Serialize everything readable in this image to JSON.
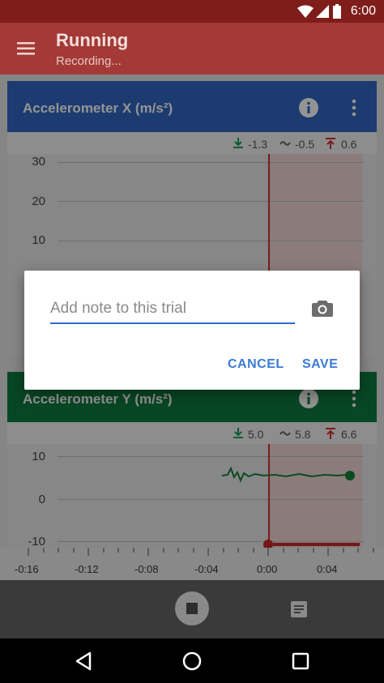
{
  "status_bar": {
    "time": "6:00",
    "icons": [
      "wifi-icon",
      "cell-signal-icon",
      "battery-icon"
    ]
  },
  "app_bar": {
    "title": "Running",
    "subtitle": "Recording...",
    "menu_icon": "hamburger-menu-icon"
  },
  "card_x": {
    "title": "Accelerometer X (m/s²)",
    "color": "#3167c1",
    "stats": {
      "min": "-1.3",
      "avg": "-0.5",
      "max": "0.6"
    },
    "y_ticks": [
      "30",
      "20",
      "10"
    ]
  },
  "card_y": {
    "title": "Accelerometer Y (m/s²)",
    "color": "#0f7a3e",
    "stats": {
      "min": "5.0",
      "avg": "5.8",
      "max": "6.6"
    },
    "y_ticks": [
      "10",
      "0",
      "-10"
    ]
  },
  "x_axis": {
    "ticks": [
      "-0:16",
      "-0:12",
      "-0:08",
      "-0:04",
      "0:00",
      "0:04"
    ]
  },
  "dialog": {
    "placeholder": "Add note to this trial",
    "value": "",
    "camera_icon": "camera-icon",
    "cancel_label": "CANCEL",
    "save_label": "SAVE"
  },
  "controls": {
    "stop_icon": "stop-icon",
    "notes_icon": "notes-icon"
  },
  "nav": {
    "back": "back-icon",
    "home": "home-icon",
    "recents": "recents-icon"
  },
  "colors": {
    "accent": "#3a7bd5",
    "recording": "#c62828",
    "status_bar": "#7f1d1a",
    "app_bar": "#a33a35"
  }
}
